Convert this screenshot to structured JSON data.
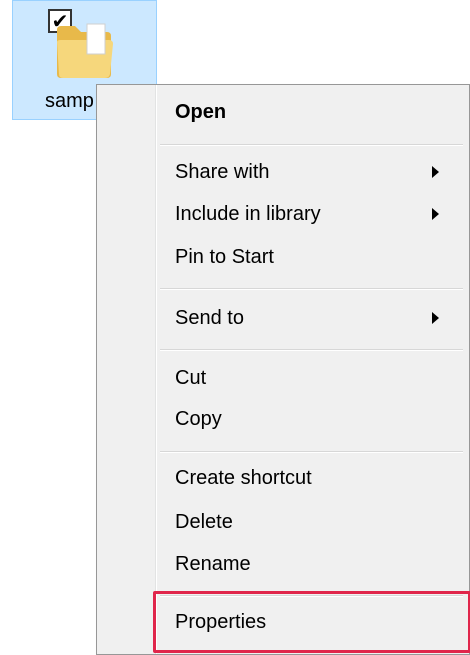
{
  "desktop": {
    "folder_label": "samp",
    "checkbox_mark": "✔",
    "folder_icon": "folder-icon"
  },
  "menu": {
    "items": [
      {
        "label": "Open",
        "bold": true,
        "has_submenu": false
      },
      {
        "label": "Share with",
        "has_submenu": true
      },
      {
        "label": "Include in library",
        "has_submenu": true
      },
      {
        "label": "Pin to Start",
        "has_submenu": false
      },
      {
        "label": "Send to",
        "has_submenu": true
      },
      {
        "label": "Cut",
        "has_submenu": false
      },
      {
        "label": "Copy",
        "has_submenu": false
      },
      {
        "label": "Create shortcut",
        "has_submenu": false
      },
      {
        "label": "Delete",
        "has_submenu": false
      },
      {
        "label": "Rename",
        "has_submenu": false
      },
      {
        "label": "Properties",
        "has_submenu": false,
        "highlighted": true
      }
    ],
    "submenu_icon": "chevron-right-icon"
  },
  "colors": {
    "selection_bg": "#cce8ff",
    "menu_bg": "#f0f0f0",
    "highlight_border": "#e0264b"
  }
}
